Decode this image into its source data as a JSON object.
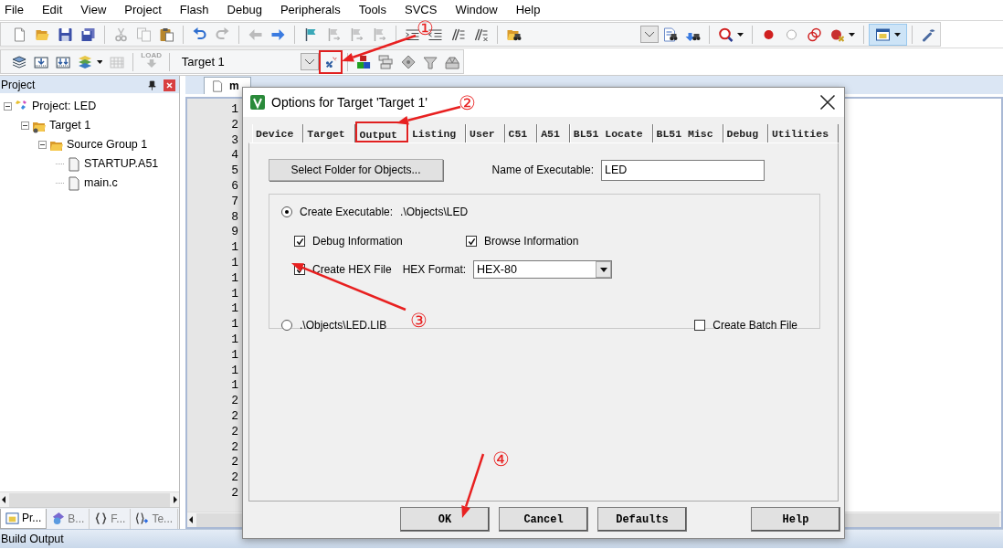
{
  "menu_bar": [
    "File",
    "Edit",
    "View",
    "Project",
    "Flash",
    "Debug",
    "Peripherals",
    "Tools",
    "SVCS",
    "Window",
    "Help"
  ],
  "toolbar_1": [
    {
      "kind": "button",
      "disabled": false
    },
    {
      "kind": "button",
      "disabled": false
    },
    {
      "kind": "button",
      "disabled": false
    },
    {
      "kind": "button",
      "disabled": false
    },
    {
      "kind": "separator"
    },
    {
      "kind": "button",
      "disabled": true
    },
    {
      "kind": "button",
      "disabled": true
    },
    {
      "kind": "button",
      "disabled": false
    },
    {
      "kind": "separator"
    },
    {
      "kind": "button",
      "disabled": false
    },
    {
      "kind": "button",
      "disabled": true
    },
    {
      "kind": "separator"
    },
    {
      "kind": "button",
      "disabled": true
    },
    {
      "kind": "button",
      "disabled": false
    },
    {
      "kind": "separator"
    },
    {
      "kind": "button",
      "disabled": false
    },
    {
      "kind": "button",
      "disabled": true
    },
    {
      "kind": "button",
      "disabled": true
    },
    {
      "kind": "button",
      "disabled": true
    },
    {
      "kind": "separator"
    },
    {
      "kind": "button",
      "disabled": false
    },
    {
      "kind": "button",
      "disabled": false
    },
    {
      "kind": "button",
      "disabled": false
    },
    {
      "kind": "button",
      "disabled": false
    },
    {
      "kind": "separator"
    },
    {
      "kind": "button",
      "disabled": false
    },
    {
      "kind": "spacer"
    },
    {
      "kind": "combo"
    },
    {
      "kind": "button",
      "disabled": false
    },
    {
      "kind": "button",
      "disabled": false
    },
    {
      "kind": "separator"
    },
    {
      "kind": "menu_button",
      "disabled": false
    },
    {
      "kind": "separator"
    },
    {
      "kind": "button",
      "disabled": false
    },
    {
      "kind": "button",
      "disabled": false
    },
    {
      "kind": "button",
      "disabled": false
    },
    {
      "kind": "menu_button",
      "disabled": false
    },
    {
      "kind": "separator"
    },
    {
      "kind": "toggle",
      "on": true
    },
    {
      "kind": "separator"
    },
    {
      "kind": "button",
      "disabled": false
    }
  ],
  "toolbar_2": [
    {
      "kind": "button",
      "disabled": false,
      "annotated": false
    },
    {
      "kind": "button",
      "disabled": false,
      "annotated": false
    },
    {
      "kind": "button",
      "disabled": false,
      "annotated": false
    },
    {
      "kind": "menu_button",
      "disabled": false,
      "annotated": false
    },
    {
      "kind": "button",
      "disabled": true,
      "annotated": false
    },
    {
      "kind": "separator"
    },
    {
      "kind": "label_button",
      "label": "LOAD",
      "disabled": true,
      "annotated": false
    },
    {
      "kind": "separator"
    },
    {
      "kind": "select",
      "value": "Target 1"
    },
    {
      "kind": "button",
      "disabled": false,
      "annotated": true
    },
    {
      "kind": "separator"
    },
    {
      "kind": "button",
      "disabled": false,
      "annotated": false
    },
    {
      "kind": "button",
      "disabled": false,
      "annotated": false
    },
    {
      "kind": "button",
      "disabled": false,
      "annotated": false
    },
    {
      "kind": "button",
      "disabled": false,
      "annotated": false
    },
    {
      "kind": "button",
      "disabled": false,
      "annotated": false
    }
  ],
  "project_panel": {
    "title": "Project",
    "tree": [
      {
        "kind": "project",
        "label": "Project: LED",
        "expanded": true,
        "children": [
          {
            "kind": "target",
            "label": "Target 1",
            "expanded": true,
            "children": [
              {
                "kind": "group",
                "label": "Source Group 1",
                "expanded": true,
                "children": [
                  {
                    "kind": "file",
                    "label": "STARTUP.A51"
                  },
                  {
                    "kind": "file",
                    "label": "main.c"
                  }
                ]
              }
            ]
          }
        ]
      }
    ],
    "tabs": [
      {
        "label": "Pr...",
        "selected": true
      },
      {
        "label": "B...",
        "selected": false
      },
      {
        "label": "F...",
        "selected": false
      },
      {
        "label": "Te...",
        "selected": false
      }
    ]
  },
  "editor": {
    "tab": "m",
    "line_numbers": [
      "1",
      "2",
      "3",
      "4",
      "5",
      "6",
      "7",
      "8",
      "9",
      "1",
      "1",
      "1",
      "1",
      "1",
      "1",
      "1",
      "1",
      "1",
      "1",
      "2",
      "2",
      "2",
      "2",
      "2",
      "2",
      "2"
    ]
  },
  "dialog": {
    "title": "Options for Target 'Target 1'",
    "tabs": [
      {
        "label": "Device",
        "selected": false,
        "annotated": false
      },
      {
        "label": "Target",
        "selected": false,
        "annotated": false
      },
      {
        "label": "Output",
        "selected": true,
        "annotated": true
      },
      {
        "label": "Listing",
        "selected": false,
        "annotated": false
      },
      {
        "label": "User",
        "selected": false,
        "annotated": false
      },
      {
        "label": "C51",
        "selected": false,
        "annotated": false
      },
      {
        "label": "A51",
        "selected": false,
        "annotated": false
      },
      {
        "label": "BL51 Locate",
        "selected": false,
        "annotated": false
      },
      {
        "label": "BL51 Misc",
        "selected": false,
        "annotated": false
      },
      {
        "label": "Debug",
        "selected": false,
        "annotated": false
      },
      {
        "label": "Utilities",
        "selected": false,
        "annotated": false
      }
    ],
    "select_folder_button": "Select Folder for Objects...",
    "executable_name": {
      "label": "Name of Executable:",
      "value": "LED"
    },
    "create_executable": {
      "label": "Create Executable:",
      "path": ".\\Objects\\LED",
      "selected": true
    },
    "debug_information": {
      "label": "Debug Information",
      "checked": true
    },
    "browse_information": {
      "label": "Browse Information",
      "checked": true
    },
    "create_hex_file": {
      "label": "Create HEX File",
      "checked": true
    },
    "hex_format": {
      "label": "HEX Format:",
      "value": "HEX-80"
    },
    "create_library": {
      "label": ".\\Objects\\LED.LIB",
      "selected": false
    },
    "create_batch_file": {
      "label": "Create Batch File",
      "checked": false
    },
    "buttons": [
      "OK",
      "Cancel",
      "Defaults",
      "Help"
    ]
  },
  "build_output": {
    "title": "Build Output"
  },
  "annotations": [
    {
      "label": "①"
    },
    {
      "label": "②"
    },
    {
      "label": "③"
    },
    {
      "label": "④"
    }
  ]
}
